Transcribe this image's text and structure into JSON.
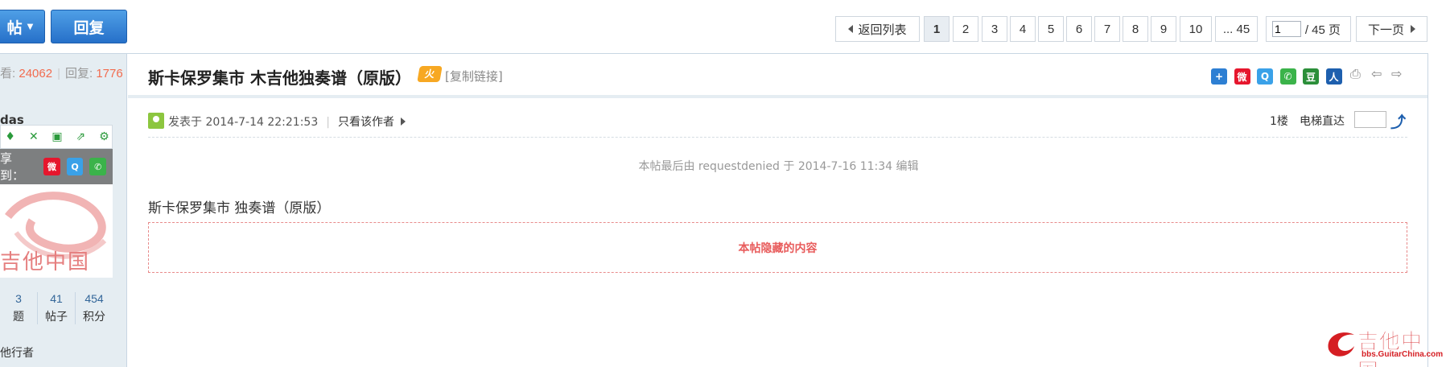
{
  "toolbar": {
    "post_label": "帖",
    "reply_label": "回复"
  },
  "pagination": {
    "back_label": "返回列表",
    "pages": [
      "1",
      "2",
      "3",
      "4",
      "5",
      "6",
      "7",
      "8",
      "9",
      "10"
    ],
    "last_page_label": "... 45",
    "input_value": "1",
    "total_label": "/ 45 页",
    "next_label": "下一页"
  },
  "sidebar": {
    "views_label": "看",
    "views_value": "24062",
    "replies_label": "回复:",
    "replies_value": "1776",
    "username": "das",
    "share_label": "享到：",
    "avatar_watermark": "吉他中国",
    "counts": [
      {
        "value": "3",
        "label": "题"
      },
      {
        "value": "41",
        "label": "帖子"
      },
      {
        "value": "454",
        "label": "积分"
      }
    ],
    "rank": "他行者"
  },
  "post": {
    "title": "斯卡保罗集市 木吉他独奏谱（原版）",
    "copy_link": "[复制链接]",
    "posted_at": "发表于 2014-7-14 22:21:53",
    "only_author": "只看该作者",
    "floor": "1楼",
    "elevator_label": "电梯直达",
    "edited_note": "本帖最后由 requestdenied 于 2014-7-16 11:34 编辑",
    "subtitle": "斯卡保罗集市 独奏谱（原版）",
    "hidden_content": "本帖隐藏的内容"
  },
  "share_icons": [
    "add-icon",
    "weibo-icon",
    "qzone-icon",
    "wechat-icon",
    "douban-icon",
    "renren-icon"
  ],
  "logo": {
    "cn": "吉他中国",
    "en": "bbs.GuitarChina.com"
  },
  "colors": {
    "accent": "#2670c9",
    "stat_number": "#f26c4f",
    "hidden_text": "#e85c5c",
    "sidebar_bg": "#e5edf2"
  }
}
